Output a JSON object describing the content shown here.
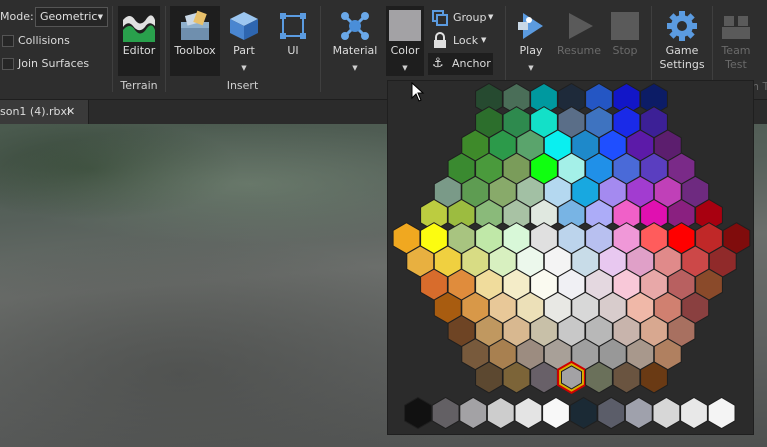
{
  "ribbon": {
    "mode_label": "Mode:",
    "mode_value": "Geometric",
    "collisions_label": "Collisions",
    "join_surfaces_label": "Join Surfaces",
    "editor_label": "Editor",
    "terrain_group_label": "Terrain",
    "toolbox_label": "Toolbox",
    "part_label": "Part",
    "ui_label": "UI",
    "insert_group_label": "Insert",
    "material_label": "Material",
    "color_label": "Color",
    "group_label": "Group",
    "lock_label": "Lock",
    "anchor_label": "Anchor",
    "play_label": "Play",
    "resume_label": "Resume",
    "stop_label": "Stop",
    "game_settings_label": "Game\nSettings",
    "team_test_label": "Team\nTest",
    "cut_label": "n T"
  },
  "tab": {
    "filename": "son1 (4).rbxl",
    "close_glyph": "✕"
  },
  "palette": {
    "selected_color": "#a3a2a5",
    "rows": [
      [
        "#264a30",
        "#4a6e58",
        "#00999f",
        "#1e2a3a",
        "#2456c4",
        "#1216c8",
        "#0c1c66"
      ],
      [
        "#2c6e2c",
        "#2e8a4e",
        "#13e0c8",
        "#5a6e88",
        "#3e73c0",
        "#1a2ae8",
        "#3c2096"
      ],
      [
        "#3e8a2a",
        "#2c9a4a",
        "#5aa46c",
        "#0aeff0",
        "#1e89ca",
        "#1f4fff",
        "#5c1aa8",
        "#5c1e6e"
      ],
      [
        "#3a8a30",
        "#4a9a3c",
        "#7a9c5a",
        "#10ff10",
        "#a4f0e8",
        "#2090e8",
        "#4a6ad8",
        "#5a3ec0",
        "#7a2a88"
      ],
      [
        "#7a9a88",
        "#5e9c52",
        "#88aa6a",
        "#a2c0a4",
        "#b4d8f0",
        "#18a8e0",
        "#a48af0",
        "#a23cd0",
        "#c040b8",
        "#6e2a80"
      ],
      [
        "#bccc40",
        "#9cbc40",
        "#8aba7a",
        "#a8c2a4",
        "#e0e8e0",
        "#78b4e4",
        "#acacf8",
        "#f060c8",
        "#e010b0",
        "#8a2080",
        "#a80010"
      ],
      [
        "#f0a820",
        "#fcfc10",
        "#a8c480",
        "#c0e8a8",
        "#d8f8d8",
        "#e0e0e0",
        "#bcd4ec",
        "#b8c0f0",
        "#f098d8",
        "#ff5c5c",
        "#ff0000",
        "#c02828",
        "#800c0c"
      ],
      [
        "#e8b040",
        "#f0d040",
        "#d8dc84",
        "#d8f0c0",
        "#ecf8ec",
        "#f4f4f4",
        "#c8dce8",
        "#e8c8f0",
        "#e0a0c8",
        "#e08a8a",
        "#cc4848",
        "#902a2a"
      ],
      [
        "#d86c2c",
        "#e08c3c",
        "#f0dc9c",
        "#f4ecc8",
        "#fafaf0",
        "#f0f0f4",
        "#e4d8e0",
        "#f8c8d8",
        "#e8a8a8",
        "#b86060",
        "#8a4a2a"
      ],
      [
        "#a85c10",
        "#d89848",
        "#e8c898",
        "#ece0b8",
        "#e8e8e4",
        "#d8d8d8",
        "#d8cccc",
        "#f0b8a8",
        "#d08070",
        "#8a4040"
      ],
      [
        "#6e4424",
        "#c09860",
        "#d8b890",
        "#c8c0a8",
        "#c8c8c8",
        "#b8b8b8",
        "#c8b4ac",
        "#d8a890",
        "#a87060"
      ],
      [
        "#785a3c",
        "#a88050",
        "#9c8c80",
        "#a8a098",
        "#a0a0a0",
        "#989898",
        "#a8988c",
        "#b08060"
      ],
      [
        "#5c4830",
        "#7c6438",
        "#686068",
        "#a3a2a5",
        "#6a705a",
        "#6a5440",
        "#6a3a14"
      ]
    ],
    "grays": [
      "#111111",
      "#636064",
      "#a3a2a5",
      "#cdcdcd",
      "#e4e4e4",
      "#f8f8f8",
      "#1b2a35",
      "#5b5d69",
      "#9fa1ac",
      "#d7d7d7",
      "#e8e8e8",
      "#f4f4f4"
    ],
    "selected_row": 12,
    "selected_col": 3
  }
}
